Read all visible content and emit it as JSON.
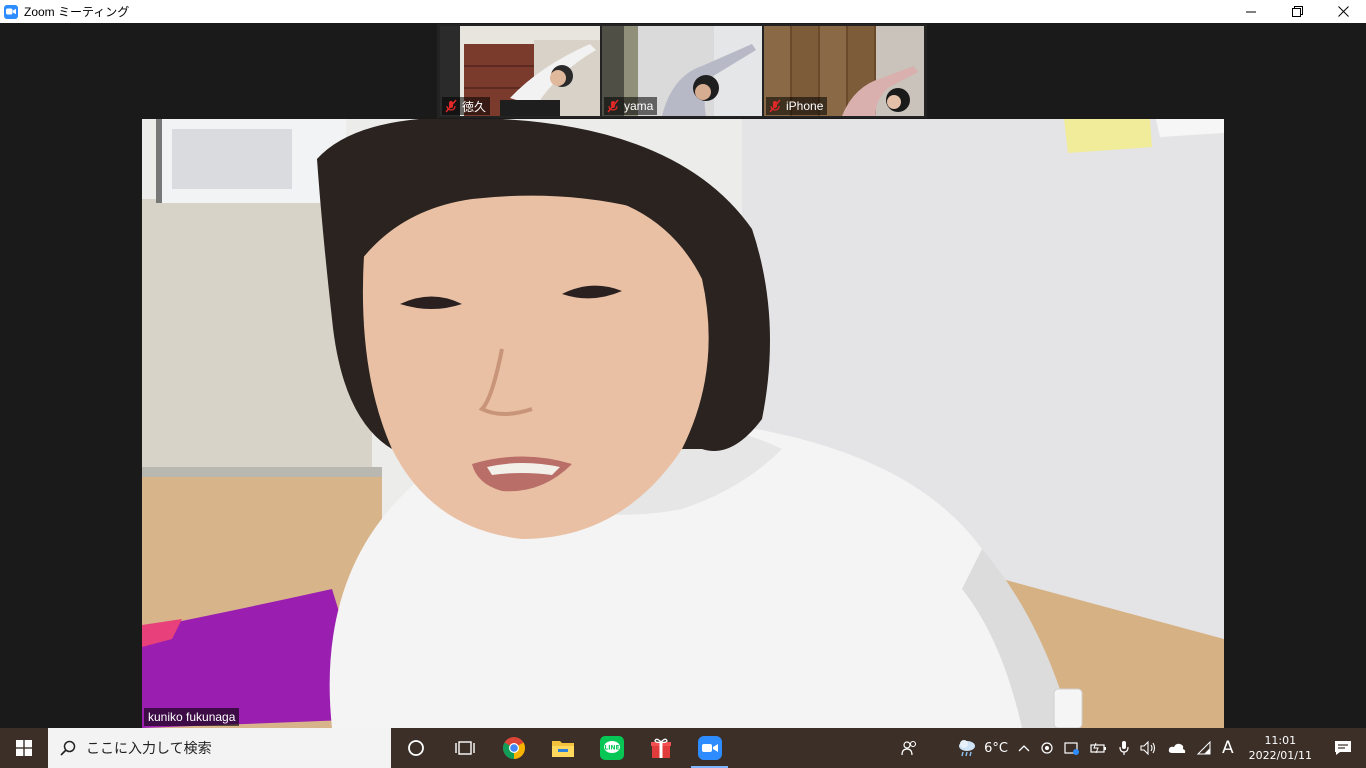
{
  "window": {
    "title": "Zoom ミーティング",
    "controls": {
      "minimize": "–",
      "restore": "❐",
      "close": "✕"
    }
  },
  "participants": [
    {
      "name": "徳久",
      "muted": true
    },
    {
      "name": "yama",
      "muted": true
    },
    {
      "name": "iPhone",
      "muted": true
    }
  ],
  "active_speaker": {
    "name": "kuniko fukunaga"
  },
  "taskbar": {
    "search_placeholder": "ここに入力して検索",
    "apps": [
      "cortana-icon",
      "task-view-icon",
      "chrome-icon",
      "file-explorer-icon",
      "line-icon",
      "gift-icon",
      "zoom-icon"
    ],
    "weather": {
      "temp": "6°C"
    },
    "ime": "A",
    "time": "11:01",
    "date": "2022/01/11"
  },
  "colors": {
    "accent": "#2d8cff",
    "mute": "#e02828",
    "taskbar": "#3b2f28"
  }
}
